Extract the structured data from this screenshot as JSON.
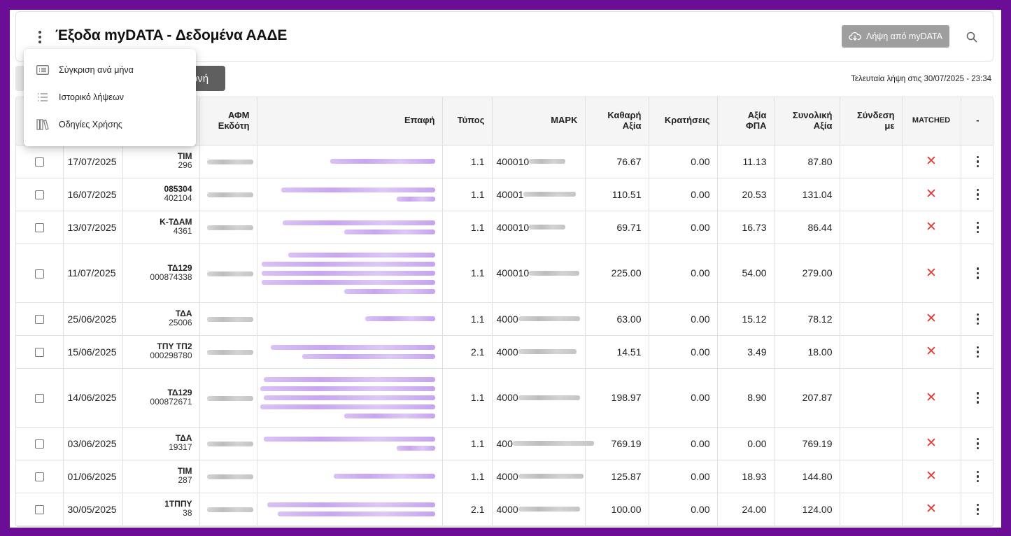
{
  "header": {
    "title": "Έξοδα myDATA - Δεδομένα ΑΑΔΕ",
    "download_button_label": "Λήψη από myDATA",
    "search_icon": "search-icon",
    "menu_icon": "kebab-icon"
  },
  "toolbar": {
    "dark_button_partial_label": "ονή",
    "last_download_text": "Τελευταία λήψη στις 30/07/2025 - 23:34"
  },
  "menu": {
    "items": [
      {
        "label": "Σύγκριση ανά μήνα",
        "icon": "list-box-icon"
      },
      {
        "label": "Ιστορικό λήψεων",
        "icon": "list-icon"
      },
      {
        "label": "Οδηγίες Χρήσης",
        "icon": "books-icon"
      }
    ]
  },
  "table": {
    "columns": {
      "afm_line1": "ΑΦΜ",
      "afm_line2": "Εκδότη",
      "contact": "Επαφή",
      "type": "Τύπος",
      "mark": "ΜΑΡΚ",
      "net_line1": "Καθαρή",
      "net_line2": "Αξία",
      "withholdings": "Κρατήσεις",
      "vat_line1": "Αξία",
      "vat_line2": "ΦΠΑ",
      "total_line1": "Συνολική",
      "total_line2": "Αξία",
      "link_line1": "Σύνδεση",
      "link_line2": "με",
      "matched": "MATCHED",
      "actions": "-"
    },
    "rows": [
      {
        "date": "17/07/2025",
        "series": "ΤΙΜ",
        "number": "296",
        "type": "1.1",
        "mark_prefix": "400010",
        "net": "76.67",
        "withholdings": "0.00",
        "vat": "11.13",
        "total": "87.80",
        "matched_icon": "close-icon"
      },
      {
        "date": "16/07/2025",
        "series": "085304",
        "number": "402104",
        "type": "1.1",
        "mark_prefix": "40001",
        "net": "110.51",
        "withholdings": "0.00",
        "vat": "20.53",
        "total": "131.04",
        "matched_icon": "close-icon"
      },
      {
        "date": "13/07/2025",
        "series": "Κ-ΤΔΑΜ",
        "number": "4361",
        "type": "1.1",
        "mark_prefix": "400010",
        "net": "69.71",
        "withholdings": "0.00",
        "vat": "16.73",
        "total": "86.44",
        "matched_icon": "close-icon"
      },
      {
        "date": "11/07/2025",
        "series": "ΤΔ129",
        "number": "000874338",
        "type": "1.1",
        "mark_prefix": "400010",
        "net": "225.00",
        "withholdings": "0.00",
        "vat": "54.00",
        "total": "279.00",
        "matched_icon": "close-icon"
      },
      {
        "date": "25/06/2025",
        "series": "ΤΔΑ",
        "number": "25006",
        "type": "1.1",
        "mark_prefix": "4000",
        "net": "63.00",
        "withholdings": "0.00",
        "vat": "15.12",
        "total": "78.12",
        "matched_icon": "close-icon"
      },
      {
        "date": "15/06/2025",
        "series": "ΤΠΥ ΤΠ2",
        "number": "000298780",
        "type": "2.1",
        "mark_prefix": "4000",
        "net": "14.51",
        "withholdings": "0.00",
        "vat": "3.49",
        "total": "18.00",
        "matched_icon": "close-icon"
      },
      {
        "date": "14/06/2025",
        "series": "ΤΔ129",
        "number": "000872671",
        "type": "1.1",
        "mark_prefix": "4000",
        "net": "198.97",
        "withholdings": "0.00",
        "vat": "8.90",
        "total": "207.87",
        "matched_icon": "close-icon"
      },
      {
        "date": "03/06/2025",
        "series": "ΤΔΑ",
        "number": "19317",
        "type": "1.1",
        "mark_prefix": "400",
        "net": "769.19",
        "withholdings": "0.00",
        "vat": "0.00",
        "total": "769.19",
        "matched_icon": "close-icon"
      },
      {
        "date": "01/06/2025",
        "series": "ΤΙΜ",
        "number": "287",
        "type": "1.1",
        "mark_prefix": "4000",
        "net": "125.87",
        "withholdings": "0.00",
        "vat": "18.93",
        "total": "144.80",
        "matched_icon": "close-icon"
      },
      {
        "date": "30/05/2025",
        "series": "1ΤΠΠΥ",
        "number": "38",
        "type": "2.1",
        "mark_prefix": "4000",
        "net": "100.00",
        "withholdings": "0.00",
        "vat": "24.00",
        "total": "124.00",
        "matched_icon": "close-icon"
      }
    ]
  },
  "colors": {
    "frame": "#6a0e98",
    "download_button": "#9e9e9e",
    "dark_button": "#5f5f5f",
    "matched_false": "#e53935"
  }
}
